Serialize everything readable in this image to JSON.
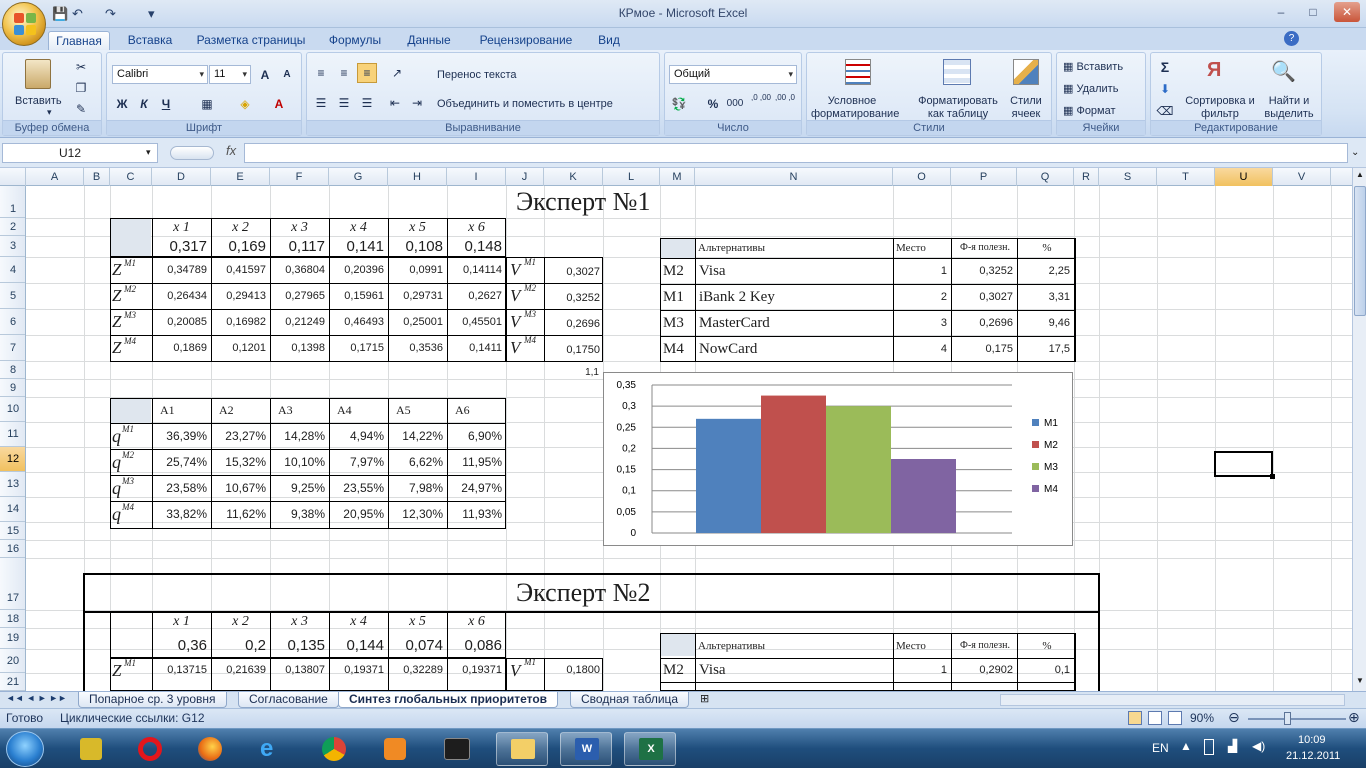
{
  "window": {
    "title": "КРмое - Microsoft Excel",
    "minimize": "–",
    "maximize": "□",
    "close": "✕"
  },
  "qat": {
    "save": "💾",
    "undo": "↶",
    "redo": "↷",
    "customize": "▾"
  },
  "tabs": [
    "Главная",
    "Вставка",
    "Разметка страницы",
    "Формулы",
    "Данные",
    "Рецензирование",
    "Вид"
  ],
  "ribbon": {
    "clipboard": {
      "label": "Буфер обмена",
      "paste": "Вставить"
    },
    "font": {
      "label": "Шрифт",
      "name": "Calibri",
      "size": "11",
      "bold": "Ж",
      "italic": "К",
      "underline": "Ч",
      "grow": "A",
      "shrink": "A"
    },
    "alignment": {
      "label": "Выравнивание",
      "wrap": "Перенос текста",
      "merge": "Объединить и поместить в центре"
    },
    "number": {
      "label": "Число",
      "format": "Общий",
      "percent": "%",
      "thousands": "000",
      "inc": ",0 ,00",
      "dec": ",00 ,0"
    },
    "styles": {
      "label": "Стили",
      "cond": "Условное форматирование",
      "table": "Форматировать как таблицу",
      "cell": "Стили ячеек"
    },
    "cells": {
      "label": "Ячейки",
      "insert": "Вставить",
      "delete": "Удалить",
      "format": "Формат"
    },
    "editing": {
      "label": "Редактирование",
      "sum": "Σ",
      "sort": "Сортировка и фильтр",
      "find": "Найти и выделить"
    }
  },
  "formula": {
    "namebox": "U12",
    "fx": "fx",
    "value": ""
  },
  "columns": [
    "A",
    "B",
    "C",
    "D",
    "E",
    "F",
    "G",
    "H",
    "I",
    "J",
    "K",
    "L",
    "M",
    "N",
    "O",
    "P",
    "Q",
    "R",
    "S",
    "T",
    "U",
    "V"
  ],
  "rows": [
    "1",
    "2",
    "3",
    "4",
    "5",
    "6",
    "7",
    "8",
    "9",
    "10",
    "11",
    "12",
    "13",
    "14",
    "15",
    "16",
    "17",
    "18",
    "19",
    "20",
    "21"
  ],
  "expert1": {
    "title": "Эксперт №1",
    "x_labels": [
      "x 1",
      "x 2",
      "x 3",
      "x 4",
      "x 5",
      "x 6"
    ],
    "weights": [
      "0,317",
      "0,169",
      "0,117",
      "0,141",
      "0,108",
      "0,148"
    ],
    "z_labels": [
      "Z",
      "Z",
      "Z",
      "Z"
    ],
    "z_sup": [
      "M1",
      "M2",
      "M3",
      "M4"
    ],
    "z_rows": [
      [
        "0,34789",
        "0,41597",
        "0,36804",
        "0,20396",
        "0,0991",
        "0,14114"
      ],
      [
        "0,26434",
        "0,29413",
        "0,27965",
        "0,15961",
        "0,29731",
        "0,2627"
      ],
      [
        "0,20085",
        "0,16982",
        "0,21249",
        "0,46493",
        "0,25001",
        "0,45501"
      ],
      [
        "0,1869",
        "0,1201",
        "0,1398",
        "0,1715",
        "0,3536",
        "0,1411"
      ]
    ],
    "v_labels": [
      "V",
      "V",
      "V",
      "V"
    ],
    "v_values": [
      "0,3027",
      "0,3252",
      "0,2696",
      "0,1750"
    ],
    "k8": "1,1",
    "a_labels": [
      "A1",
      "A2",
      "A3",
      "A4",
      "A5",
      "A6"
    ],
    "q_labels": [
      "q",
      "q",
      "q",
      "q"
    ],
    "q_rows": [
      [
        "36,39%",
        "23,27%",
        "14,28%",
        "4,94%",
        "14,22%",
        "6,90%"
      ],
      [
        "25,74%",
        "15,32%",
        "10,10%",
        "7,97%",
        "6,62%",
        "11,95%"
      ],
      [
        "23,58%",
        "10,67%",
        "9,25%",
        "23,55%",
        "7,98%",
        "24,97%"
      ],
      [
        "33,82%",
        "11,62%",
        "9,38%",
        "20,95%",
        "12,30%",
        "11,93%"
      ]
    ],
    "alt_headers": [
      "Альтернативы",
      "Место",
      "Ф-я полезн.",
      "%"
    ],
    "alt_rows": [
      [
        "M2",
        "Visa",
        "1",
        "0,3252",
        "2,25"
      ],
      [
        "M1",
        "iBank 2 Key",
        "2",
        "0,3027",
        "3,31"
      ],
      [
        "M3",
        "MasterCard",
        "3",
        "0,2696",
        "9,46"
      ],
      [
        "M4",
        "NowCard",
        "4",
        "0,175",
        "17,5"
      ]
    ]
  },
  "chart_data": {
    "type": "bar",
    "categories": [
      "M1",
      "M2",
      "M3",
      "M4"
    ],
    "series": [
      {
        "name": "M1",
        "values": [
          0.27
        ]
      },
      {
        "name": "M2",
        "values": [
          0.325
        ]
      },
      {
        "name": "M3",
        "values": [
          0.3
        ]
      },
      {
        "name": "M4",
        "values": [
          0.175
        ]
      }
    ],
    "yticks": [
      "0",
      "0,05",
      "0,1",
      "0,15",
      "0,2",
      "0,25",
      "0,3",
      "0,35"
    ],
    "ylim": [
      0,
      0.35
    ],
    "colors": [
      "#4f81bd",
      "#c0504d",
      "#9bbb59",
      "#8064a2"
    ],
    "legend": "right"
  },
  "expert2": {
    "title": "Эксперт №2",
    "x_labels": [
      "x 1",
      "x 2",
      "x 3",
      "x 4",
      "x 5",
      "x 6"
    ],
    "weights": [
      "0,36",
      "0,2",
      "0,135",
      "0,144",
      "0,074",
      "0,086"
    ],
    "z_row1": [
      "0,13715",
      "0,21639",
      "0,13807",
      "0,19371",
      "0,32289",
      "0,19371"
    ],
    "v1": "0,1800",
    "alt_headers": [
      "Альтернативы",
      "Место",
      "Ф-я полезн.",
      "%"
    ],
    "alt_row1": [
      "M2",
      "Visa",
      "1",
      "0,2902",
      "0,1"
    ]
  },
  "sheet_tabs": [
    "Попарное ср. 3 уровня",
    "Согласование",
    "Синтез глобальных приоритетов",
    "Сводная таблица"
  ],
  "status": {
    "ready": "Готово",
    "circular": "Циклические ссылки: G12",
    "zoom": "90%"
  },
  "tray": {
    "lang": "EN",
    "time": "10:09",
    "date": "21.12.2011"
  }
}
